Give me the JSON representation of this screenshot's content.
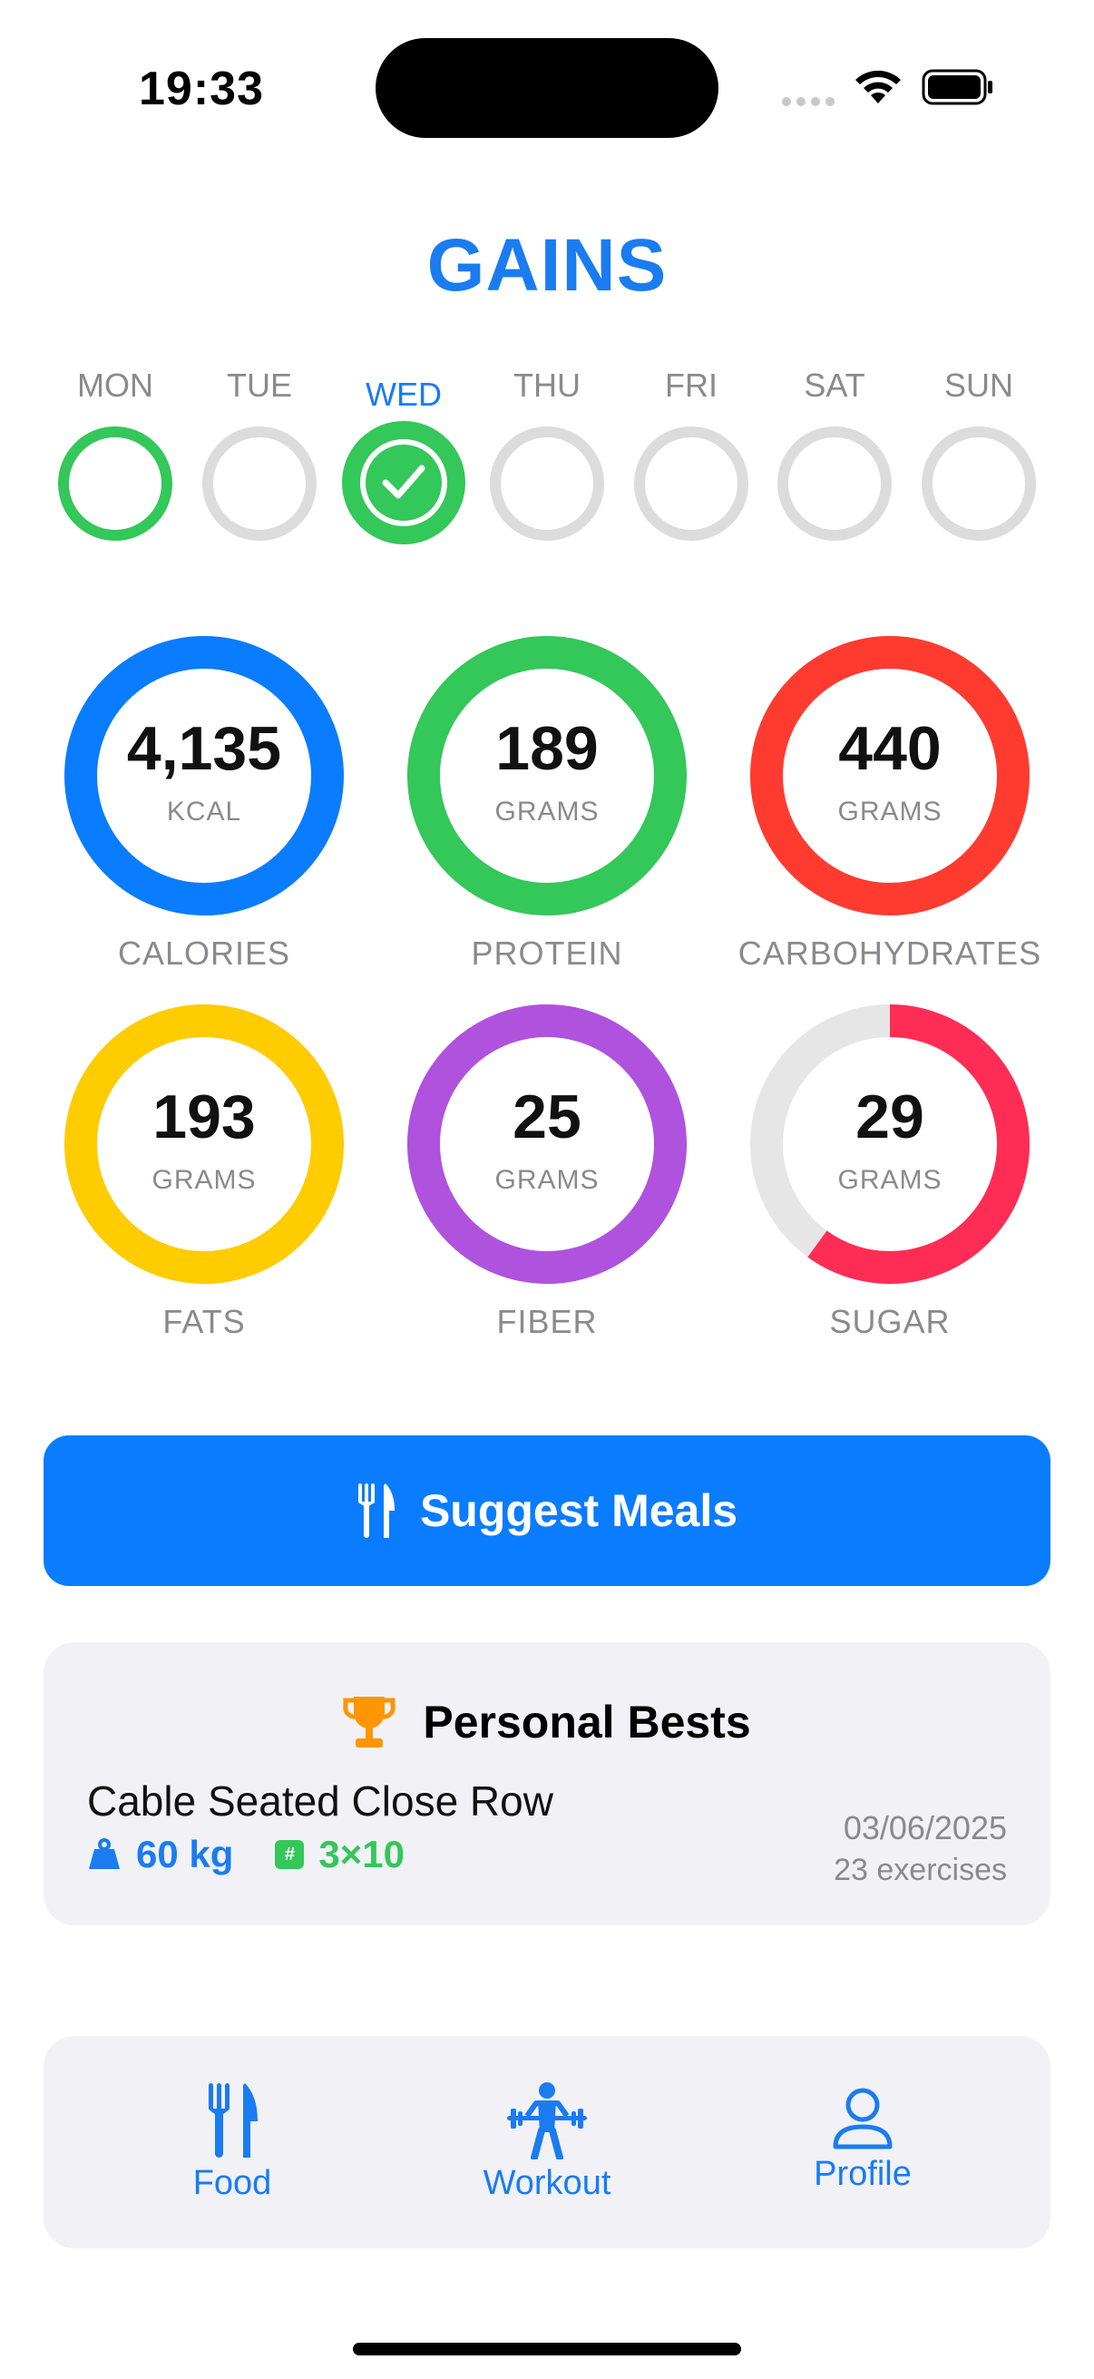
{
  "status_bar": {
    "time": "19:33"
  },
  "app_title": "GAINS",
  "week": {
    "days": [
      {
        "label": "MON",
        "state": "green-outline"
      },
      {
        "label": "TUE",
        "state": "empty"
      },
      {
        "label": "WED",
        "state": "completed",
        "selected": true
      },
      {
        "label": "THU",
        "state": "empty"
      },
      {
        "label": "FRI",
        "state": "empty"
      },
      {
        "label": "SAT",
        "state": "empty"
      },
      {
        "label": "SUN",
        "state": "empty"
      }
    ]
  },
  "macros": [
    {
      "value": "4,135",
      "unit": "KCAL",
      "label": "CALORIES",
      "color": "#0a7cff",
      "progress": 1.0
    },
    {
      "value": "189",
      "unit": "GRAMS",
      "label": "PROTEIN",
      "color": "#34c759",
      "progress": 1.0
    },
    {
      "value": "440",
      "unit": "GRAMS",
      "label": "CARBOHYDRATES",
      "color": "#ff3b30",
      "progress": 1.0
    },
    {
      "value": "193",
      "unit": "GRAMS",
      "label": "FATS",
      "color": "#ffcc00",
      "progress": 1.0
    },
    {
      "value": "25",
      "unit": "GRAMS",
      "label": "FIBER",
      "color": "#af52de",
      "progress": 1.0
    },
    {
      "value": "29",
      "unit": "GRAMS",
      "label": "SUGAR",
      "color": "#ff2d55",
      "progress": 0.6
    }
  ],
  "suggest_button": {
    "label": "Suggest Meals",
    "icon": "fork-knife-icon"
  },
  "personal_bests": {
    "title": "Personal Bests",
    "icon": "trophy-icon",
    "exercise": "Cable Seated Close Row",
    "weight": "60 kg",
    "sets": "3×10",
    "sets_icon_glyph": "#",
    "date": "03/06/2025",
    "count": "23 exercises"
  },
  "tabs": [
    {
      "label": "Food",
      "icon": "fork-knife-icon"
    },
    {
      "label": "Workout",
      "icon": "weightlifter-icon"
    },
    {
      "label": "Profile",
      "icon": "person-icon"
    }
  ],
  "colors": {
    "accent": "#1a7cf0",
    "button": "#0a7cff",
    "green": "#34c759",
    "muted": "#8a8a8e",
    "card_bg": "#f1f1f6",
    "ring_track": "#e6e6e6"
  }
}
